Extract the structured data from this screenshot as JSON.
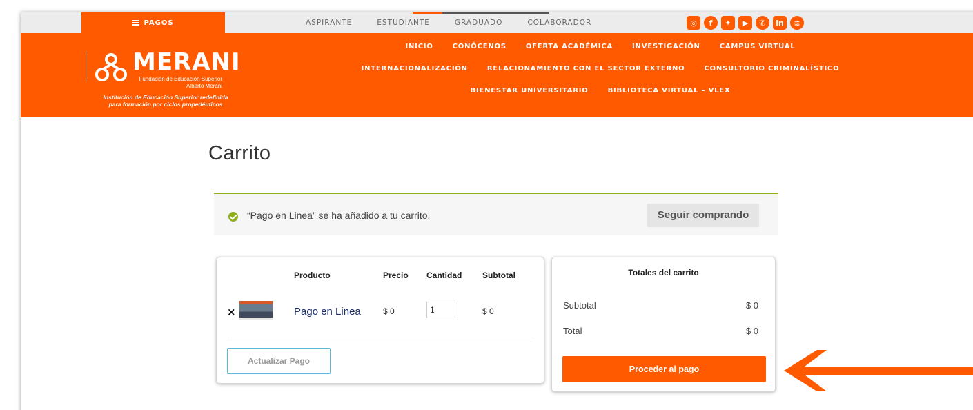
{
  "topbar": {
    "pagos_label": "PAGOS",
    "links": [
      "ASPIRANTE",
      "ESTUDIANTE",
      "GRADUADO",
      "COLABORADOR"
    ],
    "social_icons": [
      "instagram-icon",
      "facebook-icon",
      "twitter-icon",
      "youtube-icon",
      "whatsapp-icon",
      "linkedin-icon",
      "spotify-icon"
    ]
  },
  "logo": {
    "brand": "MERANI",
    "line1": "Fundación de Educación Superior",
    "line2": "Alberto Merani",
    "tagline1": "Institución de Educación Superior redefinida",
    "tagline2": "para formación por ciclos propedéuticos"
  },
  "nav": {
    "row1": [
      "INICIO",
      "CONÓCENOS",
      "OFERTA ACADÉMICA",
      "INVESTIGACIÓN",
      "CAMPUS VIRTUAL"
    ],
    "row2": [
      "INTERNACIONALIZACIÓN",
      "RELACIONAMIENTO CON EL SECTOR EXTERNO",
      "CONSULTORIO CRIMINALÍSTICO"
    ],
    "row3": [
      "BIENESTAR UNIVERSITARIO",
      "BIBLIOTECA VIRTUAL – VLEX"
    ]
  },
  "page": {
    "title": "Carrito"
  },
  "notice": {
    "message": "“Pago en Linea” se ha añadido a tu carrito.",
    "continue_label": "Seguir comprando"
  },
  "cart": {
    "headers": {
      "product": "Producto",
      "price": "Precio",
      "quantity": "Cantidad",
      "subtotal": "Subtotal"
    },
    "item": {
      "name": "Pago en Linea",
      "price": "$ 0",
      "quantity": "1",
      "subtotal": "$ 0",
      "remove": "×"
    },
    "update_label": "Actualizar Pago"
  },
  "totals": {
    "heading": "Totales del carrito",
    "subtotal_label": "Subtotal",
    "subtotal_value": "$ 0",
    "total_label": "Total",
    "total_value": "$ 0",
    "proceed_label": "Proceder al pago"
  },
  "colors": {
    "brand": "#ff5a00",
    "success": "#8fae1b",
    "link": "#1d2f6a"
  }
}
